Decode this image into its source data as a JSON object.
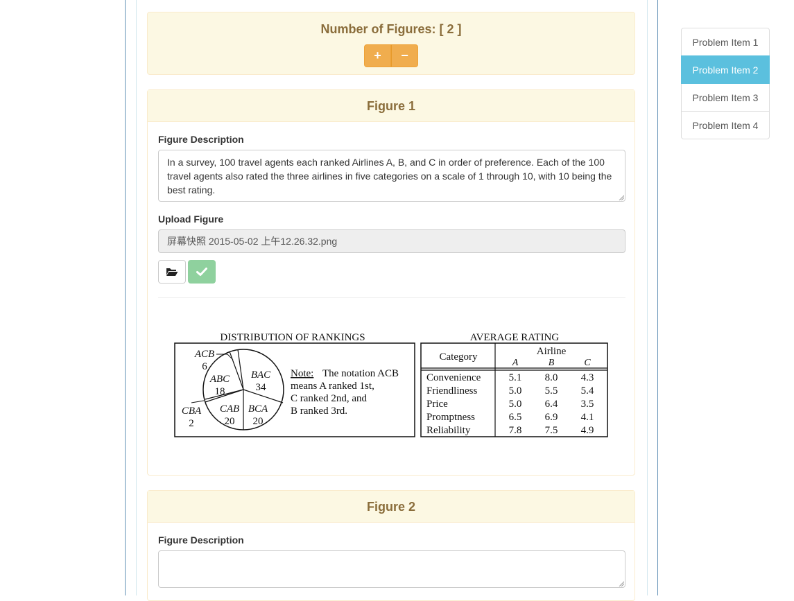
{
  "figures_count": {
    "title": "Number of Figures: [ 2 ]",
    "add_label": "+",
    "remove_label": "−"
  },
  "figure1": {
    "heading": "Figure 1",
    "description_label": "Figure Description",
    "description_value": "In a survey, 100 travel agents each ranked Airlines A, B, and C in order of preference. Each of the 100 travel agents also rated the three airlines in five categories on a scale of 1 through 10, with 10 being the best rating.",
    "upload_label": "Upload Figure",
    "upload_filename": "屏幕快照 2015-05-02 上午12.26.32.png",
    "browse_icon": "folder-open-icon",
    "confirm_icon": "check-icon",
    "image": {
      "pie_title": "DISTRIBUTION OF RANKINGS",
      "pie_slices": [
        {
          "label": "ACB",
          "value": "6"
        },
        {
          "label": "ABC",
          "value": "18"
        },
        {
          "label": "BAC",
          "value": "34"
        },
        {
          "label": "BCA",
          "value": "20"
        },
        {
          "label": "CAB",
          "value": "20"
        },
        {
          "label": "CBA",
          "value": "2"
        }
      ],
      "note_word": "Note:",
      "note_lines": [
        "The notation ACB",
        "means A ranked 1st,",
        "C ranked 2nd, and",
        "B ranked 3rd."
      ],
      "table_title": "AVERAGE RATING",
      "table_header_category": "Category",
      "table_header_group": "Airline",
      "table_columns": [
        "A",
        "B",
        "C"
      ],
      "table_rows": [
        {
          "category": "Convenience",
          "values": [
            "5.1",
            "8.0",
            "4.3"
          ]
        },
        {
          "category": "Friendliness",
          "values": [
            "5.0",
            "5.5",
            "5.4"
          ]
        },
        {
          "category": "Price",
          "values": [
            "5.0",
            "6.4",
            "3.5"
          ]
        },
        {
          "category": "Promptness",
          "values": [
            "6.5",
            "6.9",
            "4.1"
          ]
        },
        {
          "category": "Reliability",
          "values": [
            "7.8",
            "7.5",
            "4.9"
          ]
        }
      ]
    }
  },
  "figure2": {
    "heading": "Figure 2",
    "description_label": "Figure Description",
    "description_value": ""
  },
  "sidebar": {
    "items": [
      {
        "label": "Problem Item 1",
        "active": false
      },
      {
        "label": "Problem Item 2",
        "active": true
      },
      {
        "label": "Problem Item 3",
        "active": false
      },
      {
        "label": "Problem Item 4",
        "active": false
      }
    ]
  },
  "colors": {
    "warning": "#f0ad4e",
    "panel_heading": "#fcf8e3",
    "heading_text": "#8a6d3b",
    "success_light": "#8fd19e",
    "active_item": "#5bc0de"
  }
}
